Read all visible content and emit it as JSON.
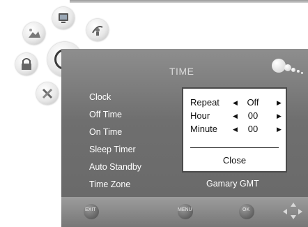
{
  "screen": {
    "title": "TIME"
  },
  "menu": {
    "items": [
      {
        "label": "Clock"
      },
      {
        "label": "Off Time"
      },
      {
        "label": "On Time"
      },
      {
        "label": "Sleep Timer"
      },
      {
        "label": "Auto Standby"
      },
      {
        "label": "Time Zone"
      }
    ],
    "time_zone_value": "Gamary GMT"
  },
  "popup": {
    "rows": [
      {
        "label": "Repeat",
        "value": "Off"
      },
      {
        "label": "Hour",
        "value": "00"
      },
      {
        "label": "Minute",
        "value": "00"
      }
    ],
    "close_label": "Close",
    "left_arrow": "◀",
    "right_arrow": "▶"
  },
  "bottom_bar": {
    "exit_label": "EXIT",
    "menu_label": "MENU",
    "ok_label": "OK"
  },
  "icons": {
    "category_icons": [
      "tv-icon",
      "satellite-icon",
      "picture-icon",
      "lock-icon",
      "clock-icon",
      "tools-icon"
    ],
    "selected": "clock-icon"
  },
  "colors": {
    "panel": "#6f6f6f",
    "popup_bg": "#ffffff",
    "text": "#ffffff"
  }
}
